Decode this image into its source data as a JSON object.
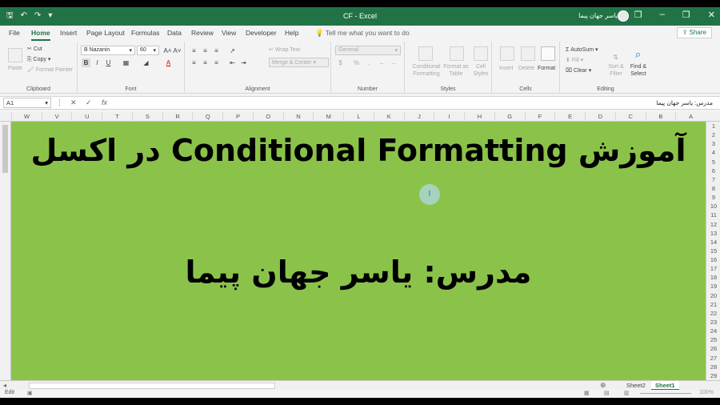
{
  "window": {
    "title": "CF - Excel",
    "user_name": "یاسر جهان پیما",
    "qat": [
      "save-icon",
      "undo-icon",
      "redo-icon",
      "customize-icon"
    ],
    "controls": [
      "minimize",
      "restore",
      "close"
    ]
  },
  "tabs": [
    "File",
    "Home",
    "Insert",
    "Page Layout",
    "Formulas",
    "Data",
    "Review",
    "View",
    "Developer",
    "Help"
  ],
  "active_tab": "Home",
  "tell_me": "Tell me what you want to do",
  "share_label": "Share",
  "ribbon": {
    "clipboard": {
      "paste": "Paste",
      "cut": "Cut",
      "copy": "Copy",
      "format_painter": "Format Painter",
      "label": "Clipboard"
    },
    "font": {
      "name": "B Nazanin",
      "size": "60",
      "bold": "B",
      "italic": "I",
      "underline": "U",
      "font_color_letter": "A",
      "label": "Font"
    },
    "alignment": {
      "wrap_text": "Wrap Text",
      "merge_center": "Merge & Center",
      "label": "Alignment"
    },
    "number": {
      "format": "General",
      "label": "Number"
    },
    "styles": {
      "conditional_formatting": "Conditional Formatting",
      "format_as_table": "Format as Table",
      "cell_styles": "Cell Styles",
      "label": "Styles"
    },
    "cells": {
      "insert": "Insert",
      "delete": "Delete",
      "format": "Format",
      "label": "Cells"
    },
    "editing": {
      "autosum": "AutoSum",
      "fill": "Fill",
      "clear": "Clear",
      "sort_filter": "Sort & Filter",
      "find_select": "Find & Select",
      "label": "Editing"
    }
  },
  "formula_bar": {
    "name_box": "A1",
    "formula": "مدرس: یاسر جهان پیما"
  },
  "columns": [
    "W",
    "V",
    "U",
    "T",
    "S",
    "R",
    "Q",
    "P",
    "O",
    "N",
    "M",
    "L",
    "K",
    "J",
    "I",
    "H",
    "G",
    "F",
    "E",
    "D",
    "C",
    "B",
    "A"
  ],
  "rows": [
    "1",
    "2",
    "3",
    "4",
    "5",
    "6",
    "7",
    "8",
    "9",
    "10",
    "11",
    "12",
    "13",
    "14",
    "15",
    "16",
    "17",
    "18",
    "19",
    "20",
    "21",
    "22",
    "23",
    "24",
    "25",
    "26",
    "27",
    "28",
    "29"
  ],
  "sheet": {
    "fill_color": "#8bc34a",
    "heading": "آموزش Conditional Formatting در اکسل",
    "teacher": "مدرس: یاسر جهان پیما",
    "cursor_label": "I"
  },
  "sheet_tabs": [
    "Sheet2",
    "Sheet1"
  ],
  "active_sheet": "Sheet1",
  "status": {
    "mode": "Edit",
    "zoom": "100%"
  },
  "colors": {
    "accent": "#217346",
    "sheet_green": "#8bc34a"
  }
}
